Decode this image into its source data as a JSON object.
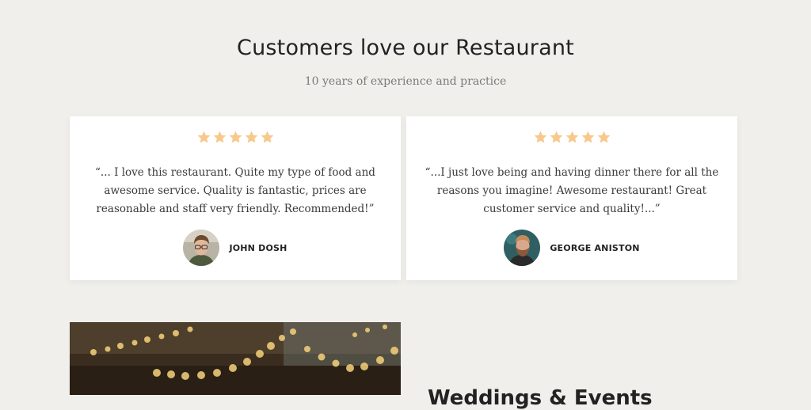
{
  "section": {
    "title": "Customers love our Restaurant",
    "subtitle": "10 years of experience and practice"
  },
  "testimonials": [
    {
      "rating": 5,
      "quote": "“... I love this restaurant. Quite my type of food and awesome service. Quality is fantastic, prices are reasonable and staff very friendly. Recommended!”",
      "author": "JOHN DOSH",
      "avatar_icon": "person-glasses-avatar"
    },
    {
      "rating": 5,
      "quote": "“...I just love being and having dinner there for all the reasons you imagine! Awesome restaurant! Great customer service and quality!...”",
      "author": "GEORGE ANISTON",
      "avatar_icon": "person-beard-avatar"
    }
  ],
  "next_section": {
    "heading": "Weddings & Events"
  },
  "colors": {
    "background": "#f0efec",
    "card": "#ffffff",
    "star": "#f8c88c",
    "heading": "#222222",
    "muted": "#7a7a7a"
  }
}
